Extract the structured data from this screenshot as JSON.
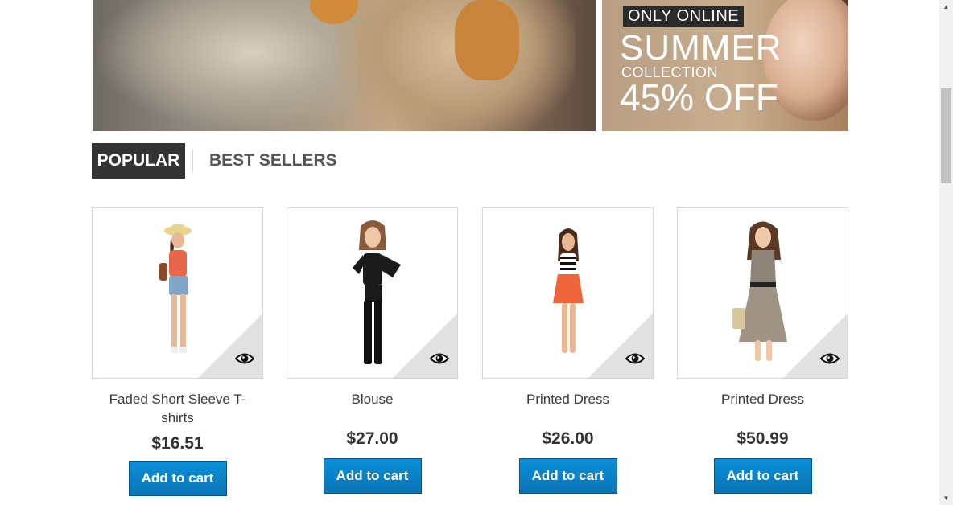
{
  "banner": {
    "slider": {
      "prev_icon": "chevron-left-icon",
      "next_icon": "chevron-right-icon"
    },
    "promo": {
      "badge": "ONLY ONLINE",
      "headline": "SUMMER",
      "subhead": "COLLECTION",
      "discount": "45% OFF"
    }
  },
  "tabs": [
    {
      "label": "POPULAR",
      "active": true
    },
    {
      "label": "BEST SELLERS",
      "active": false
    }
  ],
  "products": [
    {
      "name": "Faded Short Sleeve T-shirts",
      "price": "$16.51",
      "button": "Add to cart",
      "quick_view_icon": "eye-icon"
    },
    {
      "name": "Blouse",
      "price": "$27.00",
      "button": "Add to cart",
      "quick_view_icon": "eye-icon"
    },
    {
      "name": "Printed Dress",
      "price": "$26.00",
      "button": "Add to cart",
      "quick_view_icon": "eye-icon"
    },
    {
      "name": "Printed Dress",
      "price": "$50.99",
      "button": "Add to cart",
      "quick_view_icon": "eye-icon"
    }
  ],
  "colors": {
    "accent_button": "#0a7fc4",
    "active_tab": "#333333",
    "quick_view_corner": "#e1e1e1"
  }
}
